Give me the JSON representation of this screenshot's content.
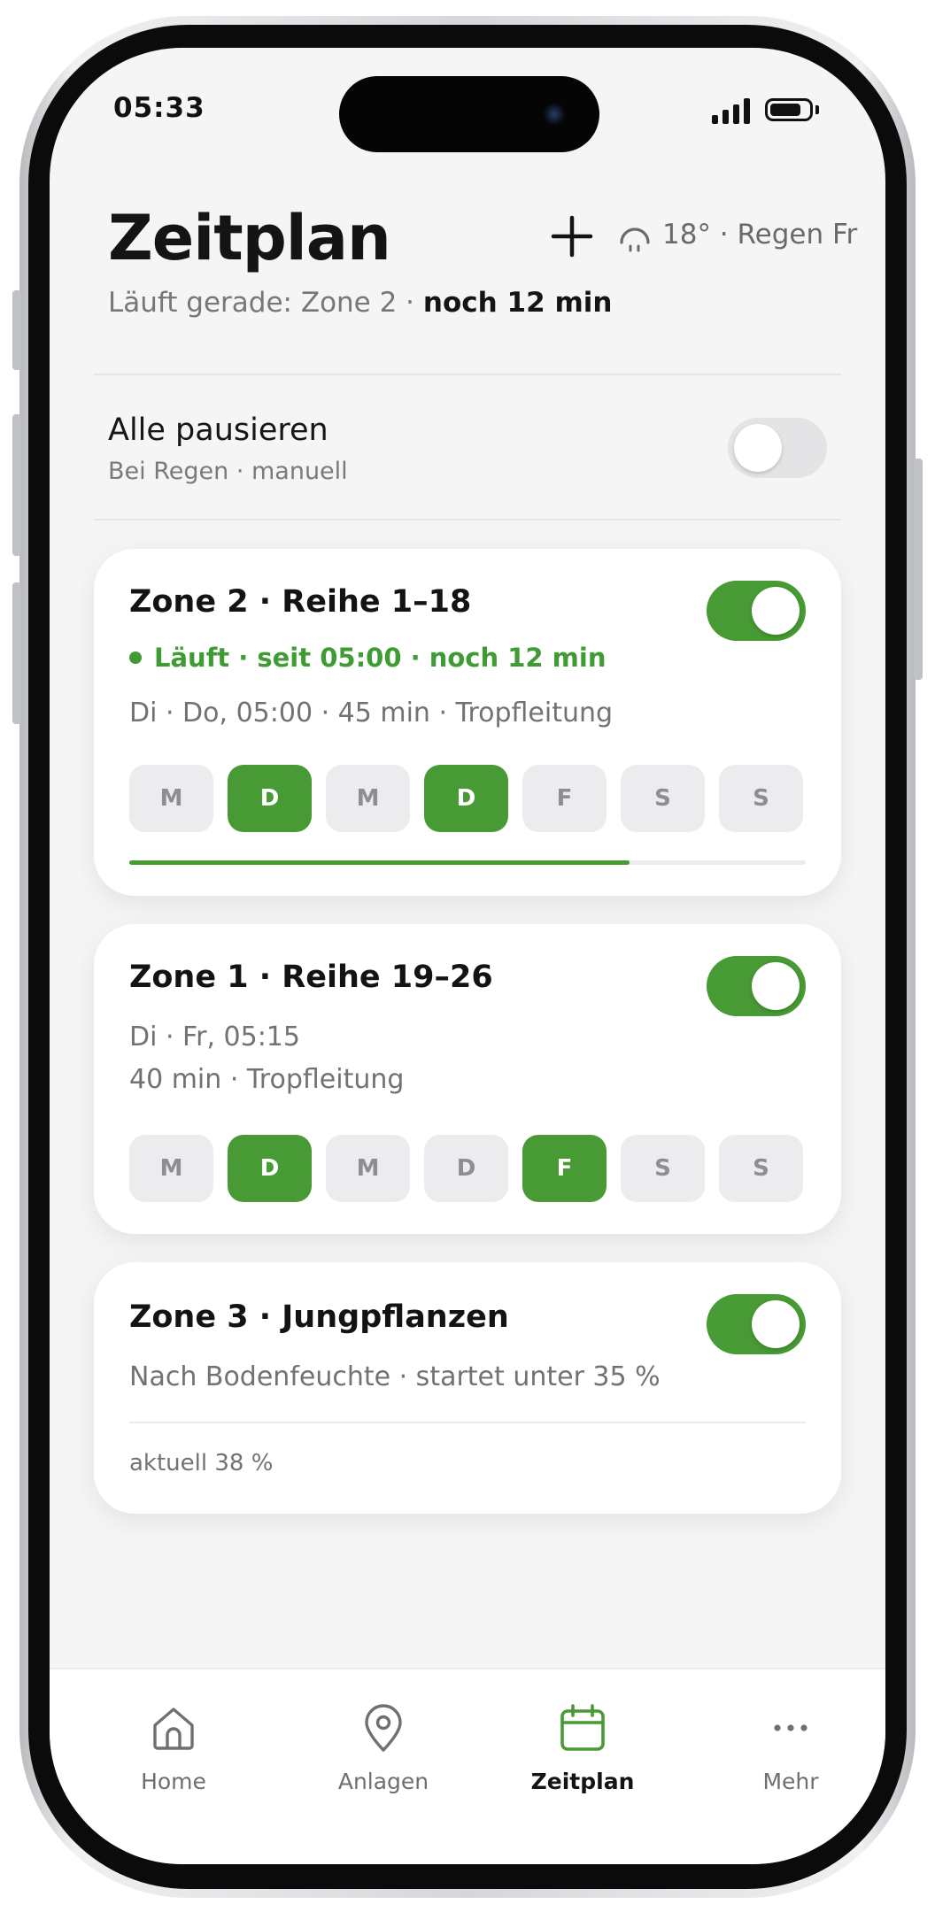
{
  "status_bar": {
    "time": "05:33"
  },
  "header": {
    "title": "Zeitplan",
    "weather": "18° · Regen Fr",
    "running_prefix": "Läuft gerade: Zone 2 ·",
    "running_remaining": "noch 12 min"
  },
  "pause_all": {
    "label": "Alle pausieren",
    "sub": "Bei Regen · manuell",
    "enabled": false
  },
  "zones": [
    {
      "title": "Zone 2 · Reihe 1–18",
      "status": "Läuft · seit 05:00 · noch 12 min",
      "schedule": "Di · Do, 05:00 · 45 min · Tropfleitung",
      "enabled": true,
      "days": [
        {
          "label": "M",
          "active": false
        },
        {
          "label": "D",
          "active": true
        },
        {
          "label": "M",
          "active": false
        },
        {
          "label": "D",
          "active": true
        },
        {
          "label": "F",
          "active": false
        },
        {
          "label": "S",
          "active": false
        },
        {
          "label": "S",
          "active": false
        }
      ],
      "progress": 0.74
    },
    {
      "title": "Zone 1 · Reihe 19–26",
      "schedule_line1": "Di · Fr, 05:15",
      "schedule_line2": "40 min · Tropfleitung",
      "enabled": true,
      "days": [
        {
          "label": "M",
          "active": false
        },
        {
          "label": "D",
          "active": true
        },
        {
          "label": "M",
          "active": false
        },
        {
          "label": "D",
          "active": false
        },
        {
          "label": "F",
          "active": true
        },
        {
          "label": "S",
          "active": false
        },
        {
          "label": "S",
          "active": false
        }
      ]
    },
    {
      "title": "Zone 3 · Jungpflanzen",
      "schedule": "Nach Bodenfeuchte · startet unter 35 %",
      "current": "aktuell 38 %",
      "enabled": true
    }
  ],
  "tabbar": {
    "items": [
      {
        "label": "Home",
        "icon": "home-icon",
        "active": false
      },
      {
        "label": "Anlagen",
        "icon": "location-pin-icon",
        "active": false
      },
      {
        "label": "Zeitplan",
        "icon": "calendar-icon",
        "active": true
      },
      {
        "label": "Mehr",
        "icon": "more-icon",
        "active": false
      }
    ]
  },
  "colors": {
    "accent": "#479a34",
    "background": "#f5f5f6",
    "card": "#ffffff"
  }
}
